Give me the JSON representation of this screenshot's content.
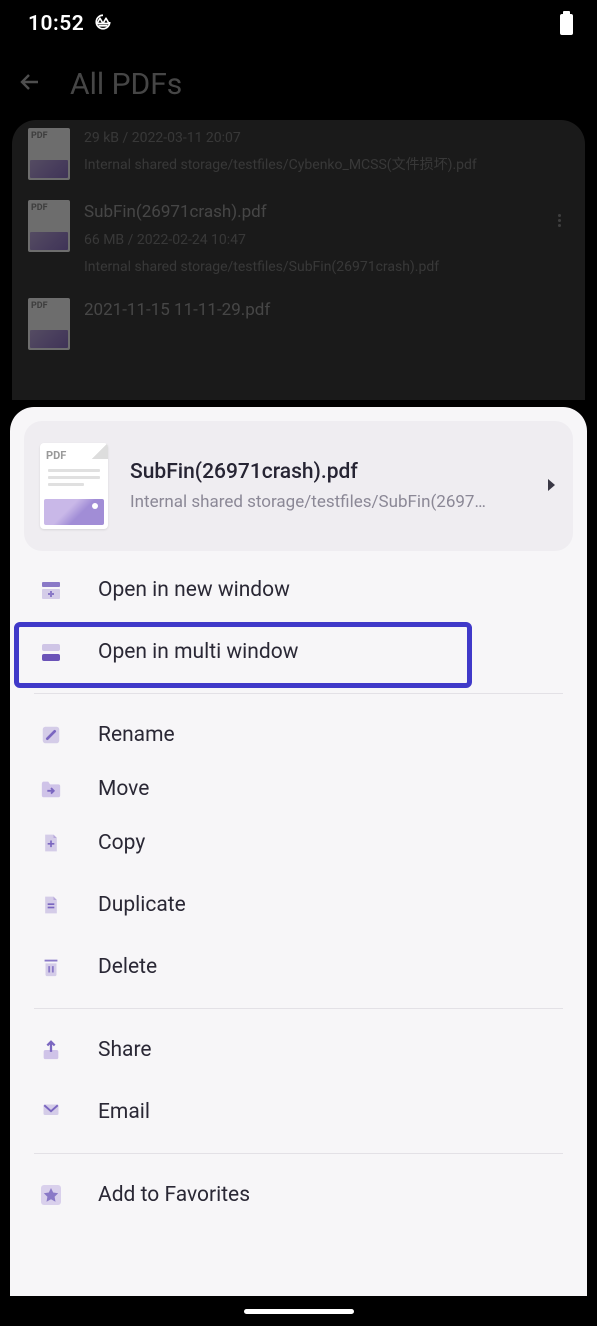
{
  "status": {
    "time": "10:52"
  },
  "header": {
    "title": "All PDFs"
  },
  "bg_items": [
    {
      "meta": "29 kB / 2022-03-11 20:07",
      "path": "Internal shared storage/testfiles/Cybenko_MCSS(文件损坏).pdf"
    },
    {
      "title": "SubFin(26971crash).pdf",
      "meta": "66 MB / 2022-02-24 10:47",
      "path": "Internal shared storage/testfiles/SubFin(26971crash).pdf"
    },
    {
      "title": "2021-11-15 11-11-29.pdf"
    }
  ],
  "sheet": {
    "filename": "SubFin(26971crash).pdf",
    "filepath": "Internal shared storage/testfiles/SubFin(2697…"
  },
  "menu": {
    "open_new_window": "Open in new window",
    "open_multi_window": "Open in multi window",
    "rename": "Rename",
    "move": "Move",
    "copy": "Copy",
    "duplicate": "Duplicate",
    "delete": "Delete",
    "share": "Share",
    "email": "Email",
    "add_favorites": "Add to Favorites"
  },
  "thumb_label": "PDF"
}
